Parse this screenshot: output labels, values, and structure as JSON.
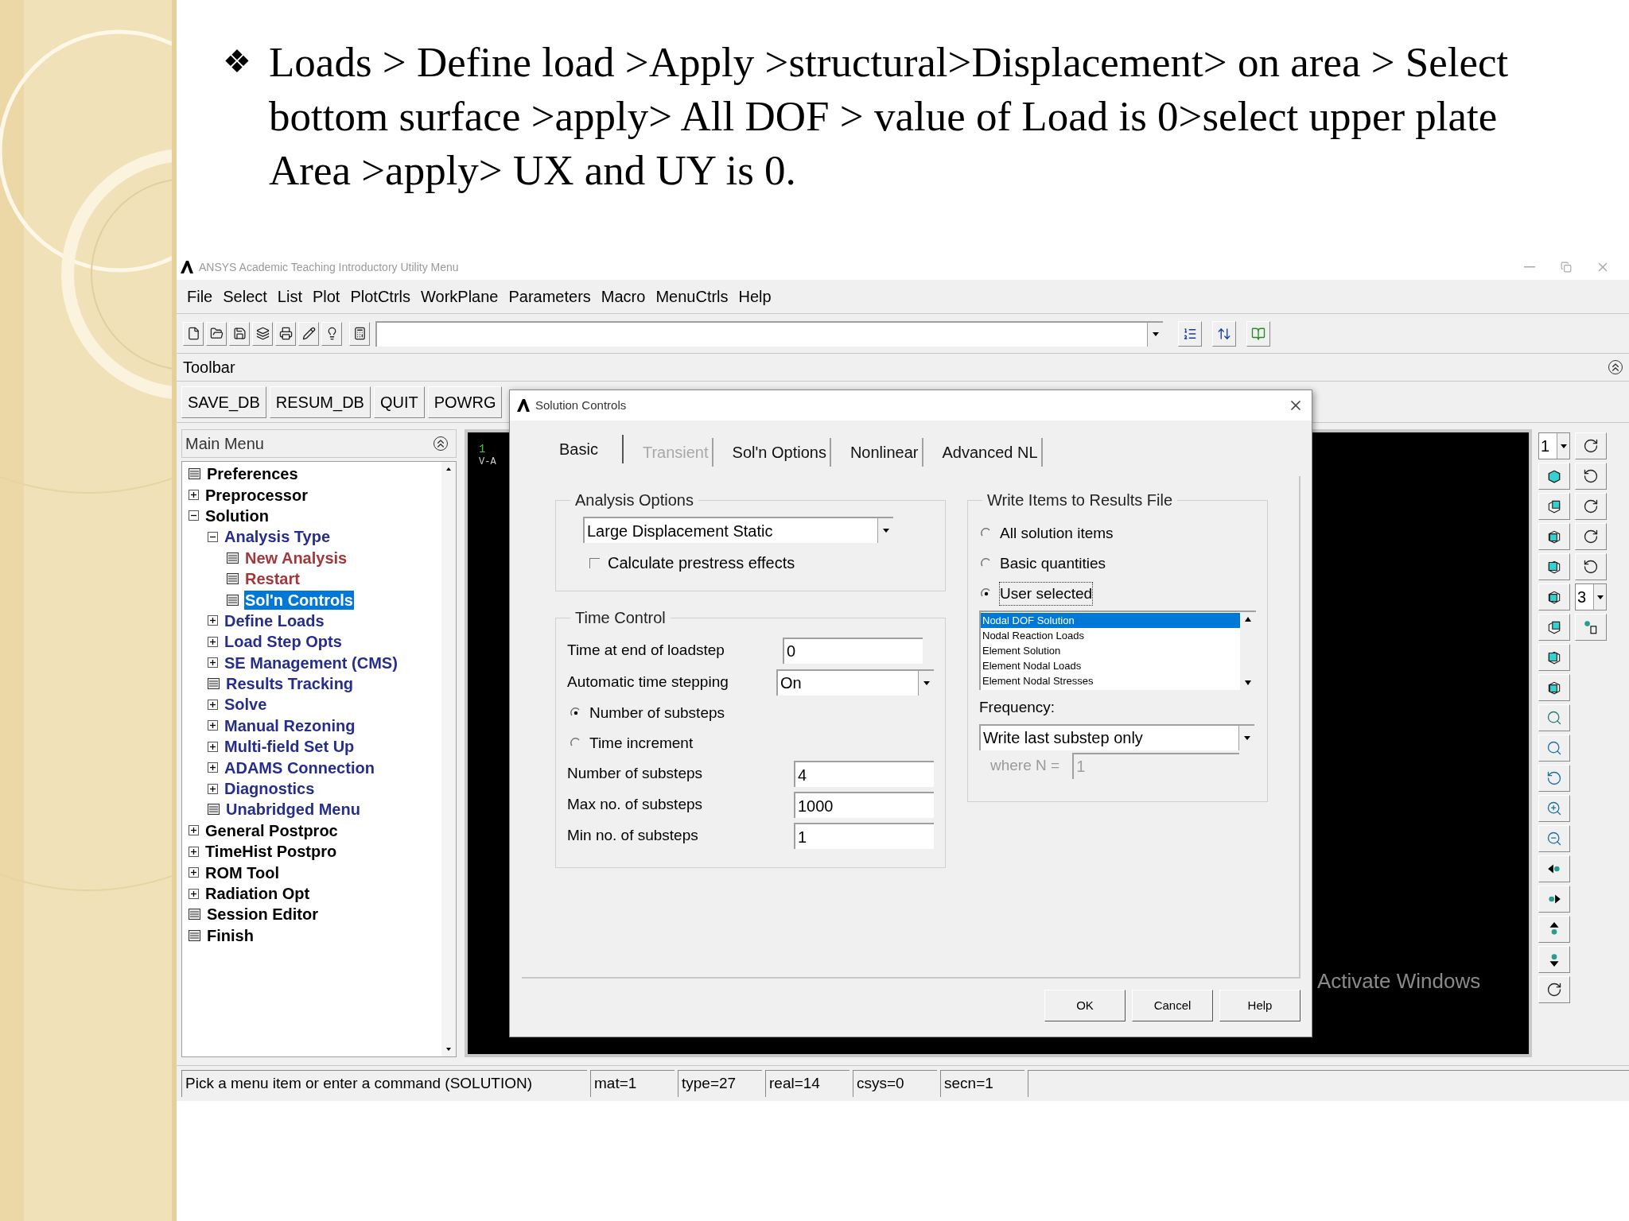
{
  "slide": {
    "bullet": "❖",
    "text": "Loads > Define load >Apply >structural>Displacement> on area > Select bottom surface >apply> All DOF > value of Load is 0>select upper plate Area >apply> UX and UY is 0."
  },
  "window": {
    "title": "ANSYS Academic Teaching Introductory Utility Menu",
    "menu": [
      "File",
      "Select",
      "List",
      "Plot",
      "PlotCtrls",
      "WorkPlane",
      "Parameters",
      "Macro",
      "MenuCtrls",
      "Help"
    ],
    "toolbar_label": "Toolbar",
    "toolbar_buttons": [
      "SAVE_DB",
      "RESUM_DB",
      "QUIT",
      "POWRG"
    ],
    "main_menu": {
      "title": "Main Menu",
      "items": [
        {
          "label": "Preferences",
          "kind": "command",
          "color": "#000000",
          "selected": false
        },
        {
          "label": "Preprocessor",
          "kind": "folder",
          "color": "#000000",
          "expanded": false,
          "selected": false
        },
        {
          "label": "Solution",
          "kind": "folder",
          "color": "#000000",
          "expanded": true,
          "selected": false,
          "children": [
            {
              "label": "Analysis Type",
              "kind": "folder",
              "color": "#262d8a",
              "expanded": true,
              "selected": false,
              "children": [
                {
                  "label": "New Analysis",
                  "kind": "command",
                  "color": "#a0383c",
                  "selected": false
                },
                {
                  "label": "Restart",
                  "kind": "command",
                  "color": "#a0383c",
                  "selected": false
                },
                {
                  "label": "Sol'n Controls",
                  "kind": "command",
                  "selected": true
                }
              ]
            },
            {
              "label": "Define Loads",
              "kind": "folder",
              "color": "#262d8a",
              "expanded": false,
              "selected": false
            },
            {
              "label": "Load Step Opts",
              "kind": "folder",
              "color": "#262d8a",
              "expanded": false,
              "selected": false
            },
            {
              "label": "SE Management (CMS)",
              "kind": "folder",
              "color": "#262d8a",
              "expanded": false,
              "selected": false
            },
            {
              "label": "Results Tracking",
              "kind": "command",
              "color": "#262d8a",
              "selected": false
            },
            {
              "label": "Solve",
              "kind": "folder",
              "color": "#262d8a",
              "expanded": false,
              "selected": false
            },
            {
              "label": "Manual Rezoning",
              "kind": "folder",
              "color": "#262d8a",
              "expanded": false,
              "selected": false
            },
            {
              "label": "Multi-field Set Up",
              "kind": "folder",
              "color": "#262d8a",
              "expanded": false,
              "selected": false
            },
            {
              "label": "ADAMS Connection",
              "kind": "folder",
              "color": "#262d8a",
              "expanded": false,
              "selected": false
            },
            {
              "label": "Diagnostics",
              "kind": "folder",
              "color": "#262d8a",
              "expanded": false,
              "selected": false
            },
            {
              "label": "Unabridged Menu",
              "kind": "command",
              "color": "#262d8a",
              "selected": false
            }
          ]
        },
        {
          "label": "General Postproc",
          "kind": "folder",
          "color": "#000000",
          "expanded": false,
          "selected": false
        },
        {
          "label": "TimeHist Postpro",
          "kind": "folder",
          "color": "#000000",
          "expanded": false,
          "selected": false
        },
        {
          "label": "ROM Tool",
          "kind": "folder",
          "color": "#000000",
          "expanded": false,
          "selected": false
        },
        {
          "label": "Radiation Opt",
          "kind": "folder",
          "color": "#000000",
          "expanded": false,
          "selected": false
        },
        {
          "label": "Session Editor",
          "kind": "command",
          "color": "#000000",
          "selected": false
        },
        {
          "label": "Finish",
          "kind": "command",
          "color": "#000000",
          "selected": false
        }
      ]
    },
    "graphics": {
      "window_number": "1",
      "label": "V-A"
    },
    "view_dropdowns": [
      "1",
      "3"
    ],
    "activation_notice": "Activate Windows",
    "status_bar": [
      "Pick a menu item or enter a command (SOLUTION)",
      "mat=1",
      "type=27",
      "real=14",
      "csys=0",
      "secn=1"
    ]
  },
  "dialog": {
    "title": "Solution Controls",
    "tabs": [
      {
        "label": "Basic",
        "selected": true,
        "disabled": false
      },
      {
        "label": "Transient",
        "selected": false,
        "disabled": true
      },
      {
        "label": "Sol'n Options",
        "selected": false,
        "disabled": false
      },
      {
        "label": "Nonlinear",
        "selected": false,
        "disabled": false
      },
      {
        "label": "Advanced NL",
        "selected": false,
        "disabled": false
      }
    ],
    "analysis_options": {
      "title": "Analysis Options",
      "type": "Large Displacement Static",
      "prestress": {
        "label": "Calculate prestress effects",
        "checked": false
      }
    },
    "time_control": {
      "title": "Time Control",
      "rows": [
        {
          "kind": "field",
          "label": "Time at end of loadstep",
          "value": "0"
        },
        {
          "kind": "dropdown",
          "label": "Automatic time stepping",
          "value": "On"
        },
        {
          "kind": "radio",
          "label": "Number of substeps",
          "selected": true
        },
        {
          "kind": "radio",
          "label": "Time increment",
          "selected": false
        },
        {
          "kind": "field",
          "label": "Number of substeps",
          "value": "4"
        },
        {
          "kind": "field",
          "label": "Max no. of substeps",
          "value": "1000"
        },
        {
          "kind": "field",
          "label": "Min no. of substeps",
          "value": "1"
        }
      ]
    },
    "write_items": {
      "title": "Write Items to Results File",
      "options": [
        {
          "label": "All solution items",
          "selected": false
        },
        {
          "label": "Basic quantities",
          "selected": false
        },
        {
          "label": "User selected",
          "selected": true
        }
      ],
      "list": [
        {
          "label": "Nodal DOF Solution",
          "selected": true
        },
        {
          "label": "Nodal Reaction Loads",
          "selected": false
        },
        {
          "label": "Element Solution",
          "selected": false
        },
        {
          "label": "Element Nodal Loads",
          "selected": false
        },
        {
          "label": "Element Nodal Stresses",
          "selected": false
        }
      ],
      "frequency_label": "Frequency:",
      "frequency": "Write last substep only",
      "where_label": "where N =",
      "where_value": "1",
      "where_disabled": true
    },
    "buttons": [
      "OK",
      "Cancel",
      "Help"
    ]
  }
}
